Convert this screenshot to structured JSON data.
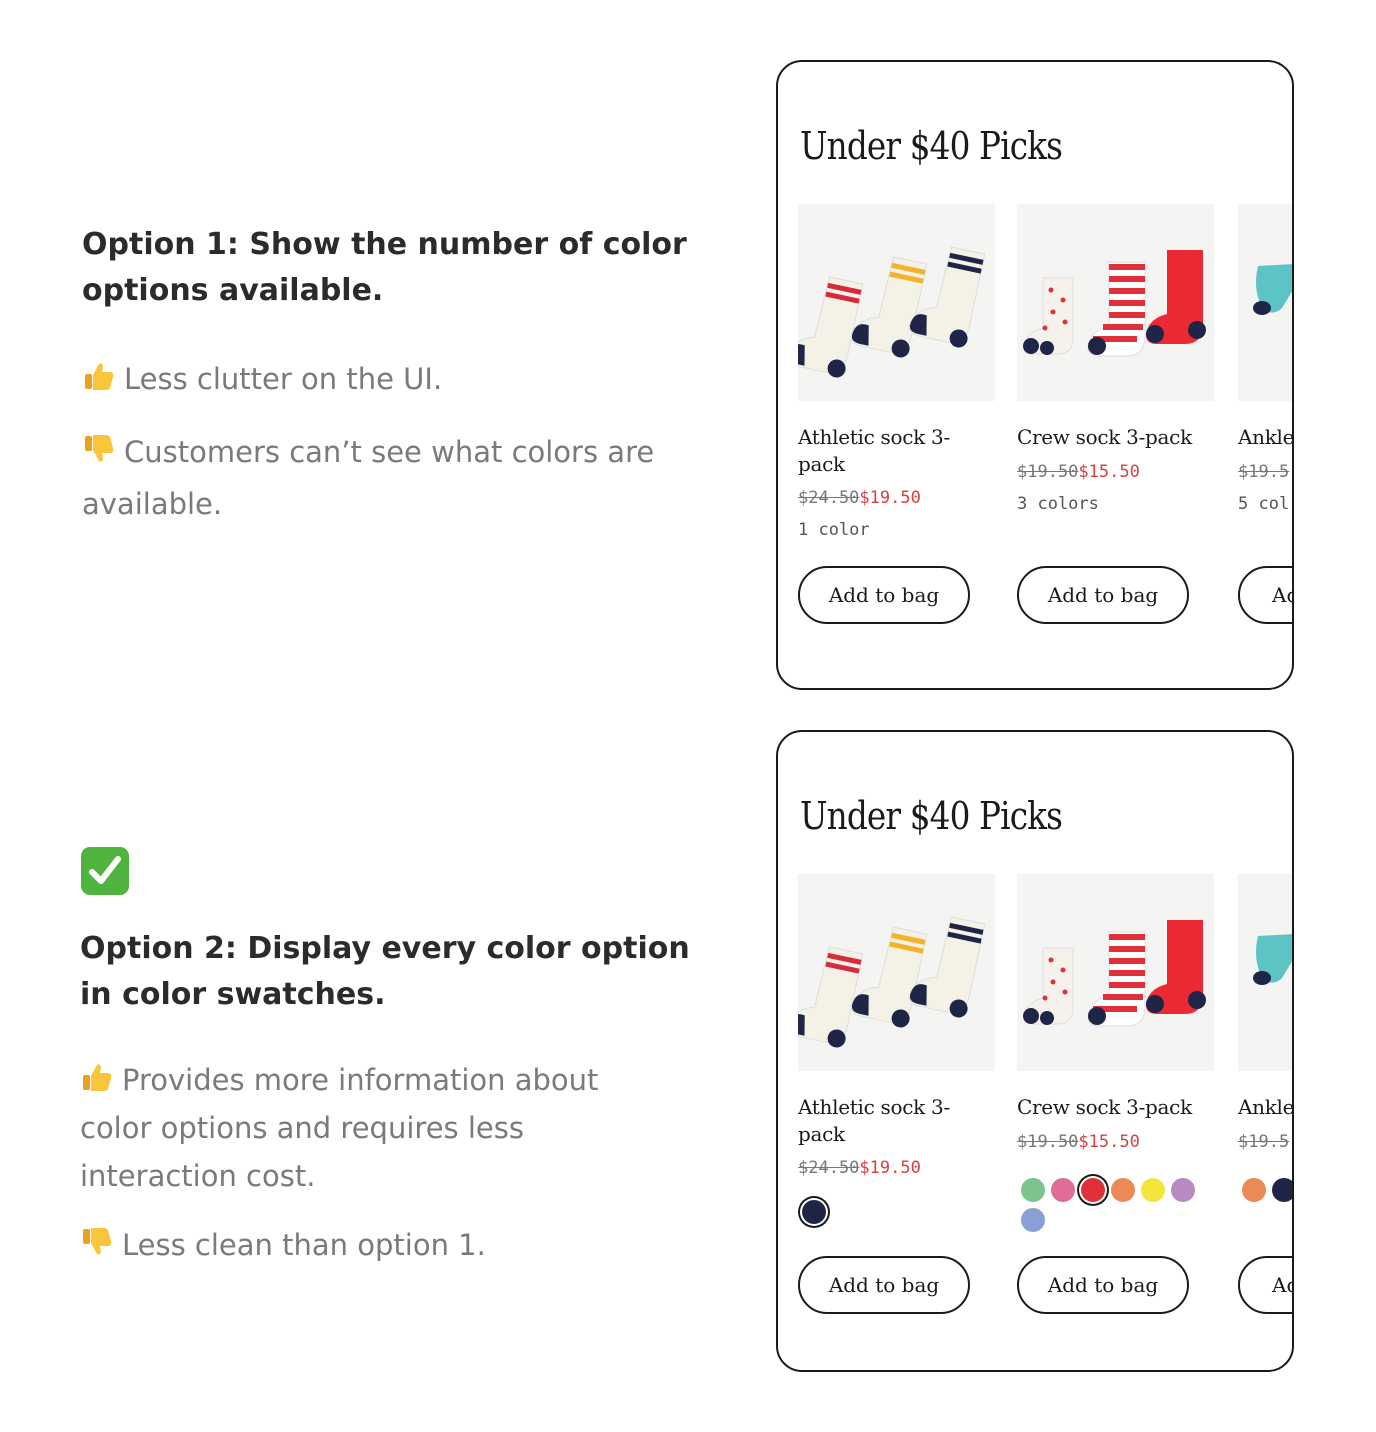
{
  "option1": {
    "title": "Option 1: Show the number of color options available.",
    "pro_icon": "thumbs-up-icon",
    "pro": "Less clutter on the UI.",
    "con_icon": "thumbs-down-icon",
    "con": "Customers can’t see what colors are available."
  },
  "option2": {
    "check_icon": "check-mark-icon",
    "title": "Option 2: Display every color option in color swatches.",
    "pro": "Provides more information about color options and requires less interaction cost.",
    "con": "Less clean than option 1."
  },
  "cards": [
    {
      "title": "Under $40 Picks",
      "products": [
        {
          "name": "Athletic sock 3-pack",
          "old_price": "$24.50",
          "new_price": "$19.50",
          "colors": "1 color",
          "button": "Add to bag"
        },
        {
          "name": "Crew sock 3-pack",
          "old_price": "$19.50",
          "new_price": "$15.50",
          "colors": "3 colors",
          "button": "Add to bag"
        },
        {
          "name": "Ankle",
          "old_price": "$19.5",
          "new_price": "",
          "colors": "5 col",
          "button": "Ad"
        }
      ]
    },
    {
      "title": "Under $40 Picks",
      "products": [
        {
          "name": "Athletic sock 3-pack",
          "old_price": "$24.50",
          "new_price": "$19.50",
          "swatches": [
            "#1f2547"
          ],
          "selected": 0,
          "button": "Add to bag"
        },
        {
          "name": "Crew sock 3-pack",
          "old_price": "$19.50",
          "new_price": "$15.50",
          "swatches": [
            "#7dc38f",
            "#e06c97",
            "#e0303a",
            "#ec8a57",
            "#f4e43e",
            "#b88ac3",
            "#8aa0d4"
          ],
          "selected": 2,
          "button": "Add to bag"
        },
        {
          "name": "Ankle",
          "old_price": "$19.5",
          "new_price": "",
          "swatches": [
            "#ec8a57",
            "#1f2547"
          ],
          "selected": -1,
          "button": "Ad"
        }
      ]
    }
  ]
}
